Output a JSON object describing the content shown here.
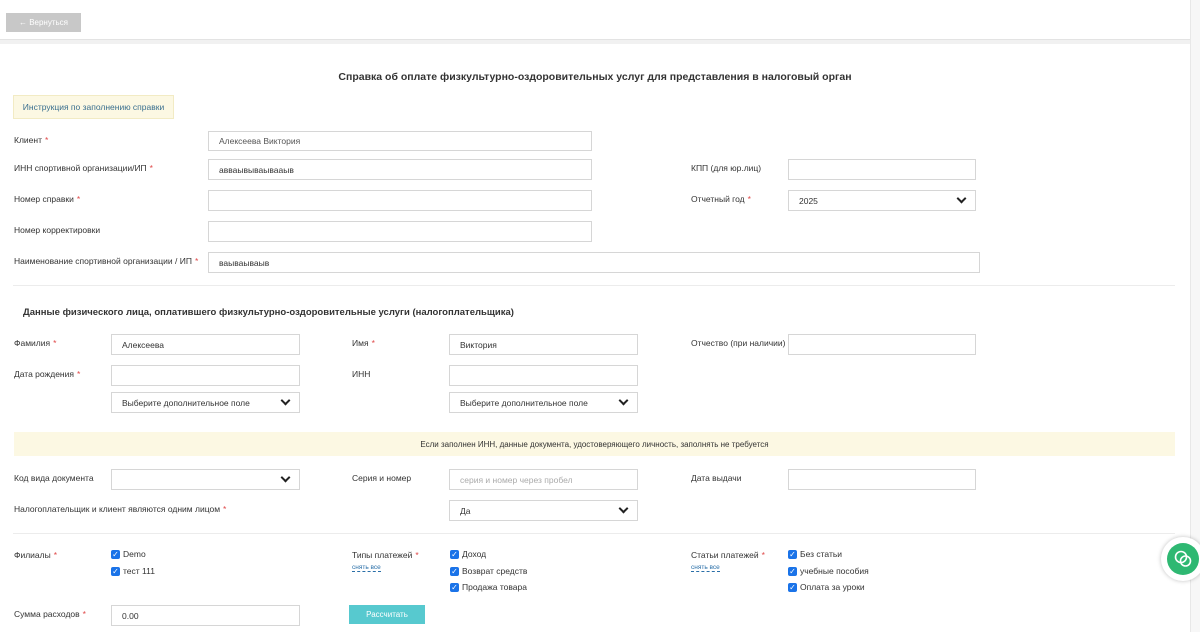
{
  "header": {
    "back_label": "← Вернуться"
  },
  "page": {
    "title": "Справка об оплате физкультурно-оздоровительных услуг для представления в налоговый орган"
  },
  "instruction": {
    "label": "Инструкция по заполнению справки"
  },
  "org": {
    "client_label": "Клиент",
    "client_value": "Алексеева Виктория",
    "inn_label": "ИНН спортивной организации/ИП",
    "inn_value": "авваывываывааыв",
    "kpp_label": "КПП (для юр.лиц)",
    "kpp_value": "",
    "cert_no_label": "Номер справки",
    "cert_no_value": "",
    "year_label": "Отчетный год",
    "year_value": "2025",
    "correction_label": "Номер корректировки",
    "correction_value": "",
    "org_name_label": "Наименование спортивной организации / ИП",
    "org_name_value": "ваываываыв"
  },
  "payer": {
    "section_title": "Данные физического лица, оплатившего физкультурно-оздоровительные услуги (налогоплательщика)",
    "surname_label": "Фамилия",
    "surname_value": "Алексеева",
    "name_label": "Имя",
    "name_value": "Виктория",
    "patronymic_label": "Отчество (при наличии)",
    "patronymic_value": "",
    "birth_label": "Дата рождения",
    "birth_value": "",
    "inn_label": "ИНН",
    "inn_value": "",
    "extra_field_1": "Выберите дополнительное поле",
    "extra_field_2": "Выберите дополнительное поле"
  },
  "notice": {
    "text": "Если заполнен ИНН, данные документа, удостоверяющего личность, заполнять не требуется"
  },
  "document": {
    "doc_code_label": "Код вида документа",
    "doc_code_value": "",
    "series_label": "Серия и номер",
    "series_placeholder": "серия и номер через пробел",
    "issue_date_label": "Дата выдачи",
    "issue_date_value": "",
    "same_person_label": "Налогоплательщик и клиент являются одним лицом",
    "same_person_value": "Да"
  },
  "filters": {
    "branches_label": "Филиалы",
    "branches": [
      "Demo",
      "тест 111"
    ],
    "payment_types_label": "Типы платежей",
    "payment_types_clear": "снять все",
    "payment_types": [
      "Доход",
      "Возврат средств",
      "Продажа товара"
    ],
    "payment_items_label": "Статьи платежей",
    "payment_items_clear": "снять все",
    "payment_items": [
      "Без статьи",
      "учебные пособия",
      "Оплата за уроки"
    ]
  },
  "sum": {
    "label": "Сумма расходов",
    "value": "0.00",
    "calc_label": "Рассчитать"
  },
  "colors": {
    "accent": "#57c9cf",
    "notice_bg": "#fcf8e3",
    "required": "#e04848",
    "checkbox": "#1a73e8",
    "chat": "#2eb872"
  },
  "icons": {
    "chat": "chat-icon",
    "checkbox": "checkbox-checked-icon",
    "chevron": "chevron-down-icon"
  }
}
